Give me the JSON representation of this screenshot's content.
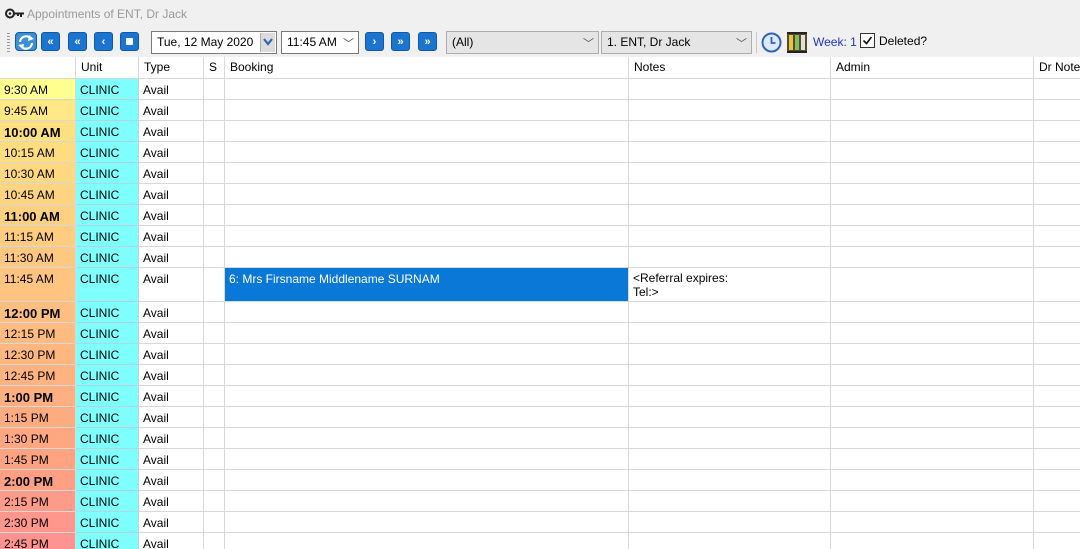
{
  "window": {
    "title": "Appointments of ENT, Dr Jack"
  },
  "toolbar": {
    "date_value": "Tue, 12 May 2020",
    "time_value": "11:45 AM",
    "filter_value": "(All)",
    "provider_value": "1. ENT, Dr Jack",
    "week_label": "Week: 1",
    "deleted_label": "Deleted?",
    "deleted_checked": true
  },
  "columns": {
    "unit": "Unit",
    "type": "Type",
    "s": "S",
    "booking": "Booking",
    "notes": "Notes",
    "admin": "Admin",
    "dr_notes": "Dr Note"
  },
  "rows": [
    {
      "time": "9:30 AM",
      "unit": "CLINIC",
      "type": "Avail",
      "booking": "",
      "notes": "",
      "hour": false,
      "color": "#ffff90"
    },
    {
      "time": "9:45 AM",
      "unit": "CLINIC",
      "type": "Avail",
      "booking": "",
      "notes": "",
      "hour": false,
      "color": "#ffe885"
    },
    {
      "time": "10:00 AM",
      "unit": "CLINIC",
      "type": "Avail",
      "booking": "",
      "notes": "",
      "hour": true,
      "color": "#ffe080"
    },
    {
      "time": "10:15 AM",
      "unit": "CLINIC",
      "type": "Avail",
      "booking": "",
      "notes": "",
      "hour": false,
      "color": "#ffdc80"
    },
    {
      "time": "10:30 AM",
      "unit": "CLINIC",
      "type": "Avail",
      "booking": "",
      "notes": "",
      "hour": false,
      "color": "#ffd880"
    },
    {
      "time": "10:45 AM",
      "unit": "CLINIC",
      "type": "Avail",
      "booking": "",
      "notes": "",
      "hour": false,
      "color": "#ffd480"
    },
    {
      "time": "11:00 AM",
      "unit": "CLINIC",
      "type": "Avail",
      "booking": "",
      "notes": "",
      "hour": true,
      "color": "#ffd080"
    },
    {
      "time": "11:15 AM",
      "unit": "CLINIC",
      "type": "Avail",
      "booking": "",
      "notes": "",
      "hour": false,
      "color": "#ffcc80"
    },
    {
      "time": "11:30 AM",
      "unit": "CLINIC",
      "type": "Avail",
      "booking": "",
      "notes": "",
      "hour": false,
      "color": "#ffc880"
    },
    {
      "time": "11:45 AM",
      "unit": "CLINIC",
      "type": "Avail",
      "booking": "6: Mrs Firsname Middlename SURNAM",
      "notes": "<Referral expires:\nTel:>",
      "hour": false,
      "color": "#ffc480",
      "tall": true
    },
    {
      "time": "12:00 PM",
      "unit": "CLINIC",
      "type": "Avail",
      "booking": "",
      "notes": "",
      "hour": true,
      "color": "#ffbf80"
    },
    {
      "time": "12:15 PM",
      "unit": "CLINIC",
      "type": "Avail",
      "booking": "",
      "notes": "",
      "hour": false,
      "color": "#ffbb80"
    },
    {
      "time": "12:30 PM",
      "unit": "CLINIC",
      "type": "Avail",
      "booking": "",
      "notes": "",
      "hour": false,
      "color": "#ffb780"
    },
    {
      "time": "12:45 PM",
      "unit": "CLINIC",
      "type": "Avail",
      "booking": "",
      "notes": "",
      "hour": false,
      "color": "#ffb380"
    },
    {
      "time": "1:00 PM",
      "unit": "CLINIC",
      "type": "Avail",
      "booking": "",
      "notes": "",
      "hour": true,
      "color": "#ffaf80"
    },
    {
      "time": "1:15 PM",
      "unit": "CLINIC",
      "type": "Avail",
      "booking": "",
      "notes": "",
      "hour": false,
      "color": "#ffab80"
    },
    {
      "time": "1:30 PM",
      "unit": "CLINIC",
      "type": "Avail",
      "booking": "",
      "notes": "",
      "hour": false,
      "color": "#ffa780"
    },
    {
      "time": "1:45 PM",
      "unit": "CLINIC",
      "type": "Avail",
      "booking": "",
      "notes": "",
      "hour": false,
      "color": "#ffa380"
    },
    {
      "time": "2:00 PM",
      "unit": "CLINIC",
      "type": "Avail",
      "booking": "",
      "notes": "",
      "hour": true,
      "color": "#ff9f84"
    },
    {
      "time": "2:15 PM",
      "unit": "CLINIC",
      "type": "Avail",
      "booking": "",
      "notes": "",
      "hour": false,
      "color": "#ff9b88"
    },
    {
      "time": "2:30 PM",
      "unit": "CLINIC",
      "type": "Avail",
      "booking": "",
      "notes": "",
      "hour": false,
      "color": "#ff978c"
    },
    {
      "time": "2:45 PM",
      "unit": "CLINIC",
      "type": "Avail",
      "booking": "",
      "notes": "",
      "hour": false,
      "color": "#ff9390"
    }
  ],
  "colors": {
    "unit_bg": "#80ffff",
    "selected_booking": "#0a78d7",
    "accent_blue": "#1b75d0",
    "week_link": "#1a37c9"
  }
}
